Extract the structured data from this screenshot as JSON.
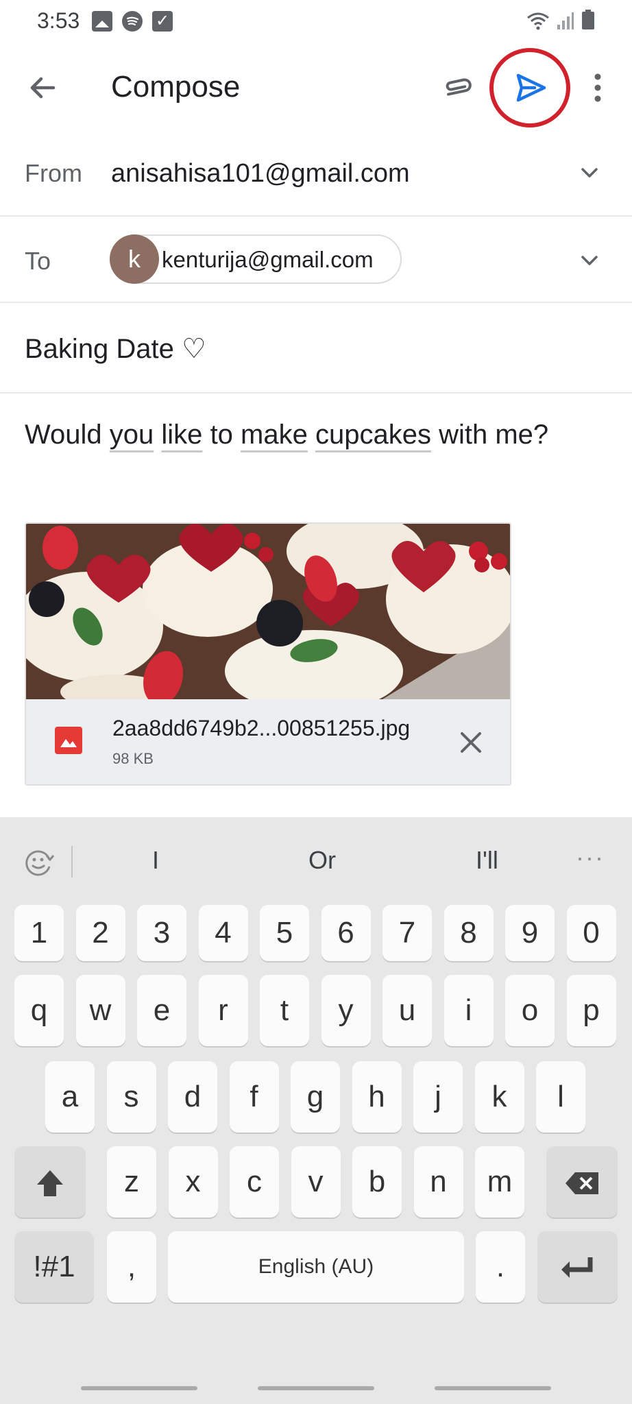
{
  "status_bar": {
    "time": "3:53"
  },
  "app_bar": {
    "title": "Compose"
  },
  "compose": {
    "from_label": "From",
    "from_value": "anisahisa101@gmail.com",
    "to_label": "To",
    "to_chip_initial": "k",
    "to_chip_email": "kenturija@gmail.com",
    "subject": "Baking Date ♡",
    "body_words": [
      "Would",
      "you",
      "like",
      "to",
      "make",
      "cupcakes",
      "with me?"
    ]
  },
  "attachment": {
    "filename": "2aa8dd6749b2...00851255.jpg",
    "size": "98 KB"
  },
  "keyboard": {
    "suggestions": [
      "I",
      "Or",
      "I'll"
    ],
    "more_label": "···",
    "number_row": [
      "1",
      "2",
      "3",
      "4",
      "5",
      "6",
      "7",
      "8",
      "9",
      "0"
    ],
    "row1": [
      "q",
      "w",
      "e",
      "r",
      "t",
      "y",
      "u",
      "i",
      "o",
      "p"
    ],
    "row2": [
      "a",
      "s",
      "d",
      "f",
      "g",
      "h",
      "j",
      "k",
      "l"
    ],
    "row3": [
      "z",
      "x",
      "c",
      "v",
      "b",
      "n",
      "m"
    ],
    "symbols_label": "!#1",
    "comma_label": ",",
    "space_label": "English (AU)",
    "period_label": "."
  },
  "colors": {
    "send_icon": "#1a73e8",
    "highlight_circle": "#d0212c",
    "avatar_bg": "#8d6e63",
    "image_icon": "#e53935"
  },
  "icons": {
    "back": "arrow-left-icon",
    "attach": "paperclip-icon",
    "send": "send-icon",
    "more": "more-vert-icon",
    "chevron": "chevron-down-icon",
    "remove": "close-icon",
    "shift": "shift-icon",
    "backspace": "backspace-icon",
    "enter": "enter-icon"
  }
}
